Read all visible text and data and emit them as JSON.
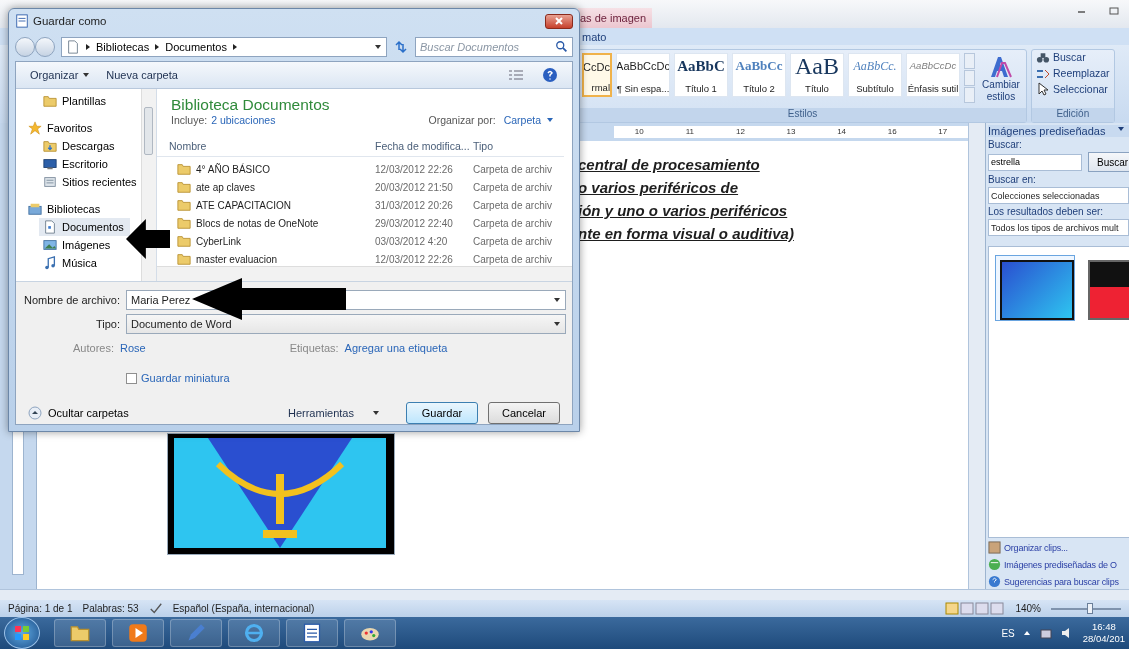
{
  "word": {
    "context_tab": "as de imagen",
    "ribbon_tab": "mato",
    "styles": [
      {
        "sample": "CcDc",
        "name": "rmal",
        "kind": "normal",
        "selected": true
      },
      {
        "sample": "AaBbCcDc",
        "name": "¶ Sin espa...",
        "kind": "normal",
        "selected": false
      },
      {
        "sample": "AaBbC",
        "name": "Título 1",
        "kind": "heading1",
        "selected": false
      },
      {
        "sample": "AaBbCc",
        "name": "Título 2",
        "kind": "heading2",
        "selected": false
      },
      {
        "sample": "AaB",
        "name": "Título",
        "kind": "title",
        "selected": false
      },
      {
        "sample": "AaBbCc.",
        "name": "Subtítulo",
        "kind": "subtitle",
        "selected": false
      },
      {
        "sample": "AaBbCcDc",
        "name": "Énfasis sutil",
        "kind": "emphasis",
        "selected": false
      }
    ],
    "styles_group": "Estilos",
    "change_styles": "Cambiar estilos",
    "edit_buttons": [
      "Buscar",
      "Reemplazar",
      "Seleccionar"
    ],
    "edit_group": "Edición",
    "ruler_numbers": [
      "10",
      "11",
      "12",
      "13",
      "14",
      "16",
      "17"
    ],
    "document_lines": [
      "central de procesamiento",
      "o varios periféricos de",
      "ión y uno o varios periféricos",
      "nte en forma visual o auditiva)"
    ],
    "task_pane": {
      "title": "Imágenes prediseñadas",
      "search_label": "Buscar:",
      "search_value": "estrella",
      "search_button": "Buscar",
      "search_in_label": "Buscar en:",
      "search_in_value": "Colecciones seleccionadas",
      "results_label": "Los resultados deben ser:",
      "results_value": "Todos los tipos de archivos mult",
      "results": [
        {
          "selected": true
        },
        {
          "selected": false
        }
      ],
      "links": [
        "Organizar clips...",
        "Imágenes prediseñadas de O",
        "Sugerencias para buscar clips"
      ]
    },
    "status_bar": {
      "page": "Página: 1 de 1",
      "words": "Palabras: 53",
      "language": "Español (España, internacional)",
      "zoom": "140%",
      "zoom_slider": {
        "level": 0.55
      }
    }
  },
  "dialog": {
    "title": "Guardar como",
    "path": [
      "Bibliotecas",
      "Documentos"
    ],
    "search_placeholder": "Buscar Documentos",
    "toolbar": [
      "Organizar",
      "Nueva carpeta"
    ],
    "nav": [
      {
        "label": "Plantillas",
        "kind": "item",
        "selected": false
      },
      {
        "label": "Favoritos",
        "kind": "group",
        "selected": false
      },
      {
        "label": "Descargas",
        "kind": "item",
        "selected": false
      },
      {
        "label": "Escritorio",
        "kind": "item",
        "selected": false
      },
      {
        "label": "Sitios recientes",
        "kind": "item",
        "selected": false
      },
      {
        "label": "Bibliotecas",
        "kind": "group",
        "selected": false
      },
      {
        "label": "Documentos",
        "kind": "item",
        "selected": true
      },
      {
        "label": "Imágenes",
        "kind": "item",
        "selected": false
      },
      {
        "label": "Música",
        "kind": "item",
        "selected": false
      }
    ],
    "library_title": "Biblioteca Documentos",
    "includes_label": "Incluye:",
    "includes_link": "2 ubicaciones",
    "arrange_label": "Organizar por:",
    "arrange_value": "Carpeta",
    "columns": [
      "Nombre",
      "Fecha de modifica...",
      "Tipo"
    ],
    "rows": [
      {
        "name": "4° AÑO BÁSICO",
        "date": "12/03/2012 22:26",
        "type": "Carpeta de archiv"
      },
      {
        "name": "ate ap claves",
        "date": "20/03/2012 21:50",
        "type": "Carpeta de archiv"
      },
      {
        "name": "ATE CAPACITACION",
        "date": "31/03/2012 20:26",
        "type": "Carpeta de archiv"
      },
      {
        "name": "Blocs de notas de OneNote",
        "date": "29/03/2012 22:40",
        "type": "Carpeta de archiv"
      },
      {
        "name": "CyberLink",
        "date": "03/03/2012 4:20",
        "type": "Carpeta de archiv"
      },
      {
        "name": "master evaluacion",
        "date": "12/03/2012 22:26",
        "type": "Carpeta de archiv"
      }
    ],
    "filename_label": "Nombre de archivo:",
    "filename": "Maria Perez",
    "type_label": "Tipo:",
    "type_value": "Documento de Word",
    "authors_label": "Autores:",
    "authors": "Rose",
    "tags_label": "Etiquetas:",
    "tags": "Agregar una etiqueta",
    "thumbnail": {
      "label": "Guardar miniatura",
      "checked": false
    },
    "hide_folders": "Ocultar carpetas",
    "tools": "Herramientas",
    "buttons": [
      "Guardar",
      "Cancelar"
    ]
  },
  "taskbar": {
    "language": "ES",
    "time": "16:48",
    "date": "28/04/201"
  }
}
